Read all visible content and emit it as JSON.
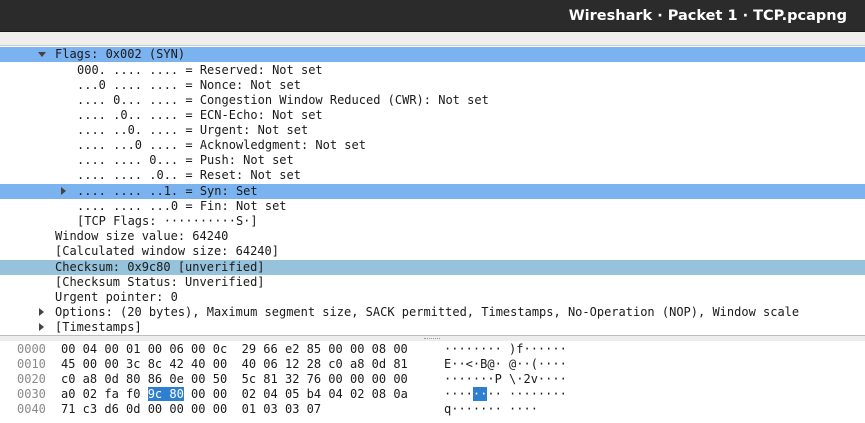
{
  "window": {
    "title": "Wireshark · Packet 1 · TCP.pcapng"
  },
  "colors": {
    "selection": "#7bb2f0",
    "checksum_selection": "#96c2dc",
    "byte_highlight": "#2f7fd1",
    "titlebar": "#2b2b2b"
  },
  "tree": {
    "flags_header": "Flags: 0x002 (SYN)",
    "flags": [
      "000. .... .... = Reserved: Not set",
      "...0 .... .... = Nonce: Not set",
      ".... 0... .... = Congestion Window Reduced (CWR): Not set",
      ".... .0.. .... = ECN-Echo: Not set",
      ".... ..0. .... = Urgent: Not set",
      ".... ...0 .... = Acknowledgment: Not set",
      ".... .... 0... = Push: Not set",
      ".... .... .0.. = Reset: Not set",
      ".... .... ..1. = Syn: Set",
      ".... .... ...0 = Fin: Not set",
      "[TCP Flags: ··········S·]"
    ],
    "window_size": "Window size value: 64240",
    "calc_window": "[Calculated window size: 64240]",
    "checksum": "Checksum: 0x9c80 [unverified]",
    "checksum_status": "[Checksum Status: Unverified]",
    "urgent": "Urgent pointer: 0",
    "options": "Options: (20 bytes), Maximum segment size, SACK permitted, Timestamps, No-Operation (NOP), Window scale",
    "timestamps": "[Timestamps]"
  },
  "bytes": [
    {
      "offset": "0000",
      "hex": "00 04 00 01 00 06 00 0c  29 66 e2 85 00 00 08 00",
      "ascii": "········ )f······"
    },
    {
      "offset": "0010",
      "hex": "45 00 00 3c 8c 42 40 00  40 06 12 28 c0 a8 0d 81",
      "ascii": "E··<·B@· @··(····"
    },
    {
      "offset": "0020",
      "hex": "c0 a8 0d 80 86 0e 00 50  5c 81 32 76 00 00 00 00",
      "ascii": "·······P \\·2v····"
    },
    {
      "offset": "0030",
      "hex_pre": "a0 02 fa f0 ",
      "hex_hl": "9c 80",
      "hex_post": " 00 00  02 04 05 b4 04 02 08 0a",
      "ascii_pre": "····",
      "ascii_hl": "··",
      "ascii_post": "·· ········"
    },
    {
      "offset": "0040",
      "hex": "71 c3 d6 0d 00 00 00 00  01 03 03 07",
      "ascii": "q······· ····"
    }
  ]
}
